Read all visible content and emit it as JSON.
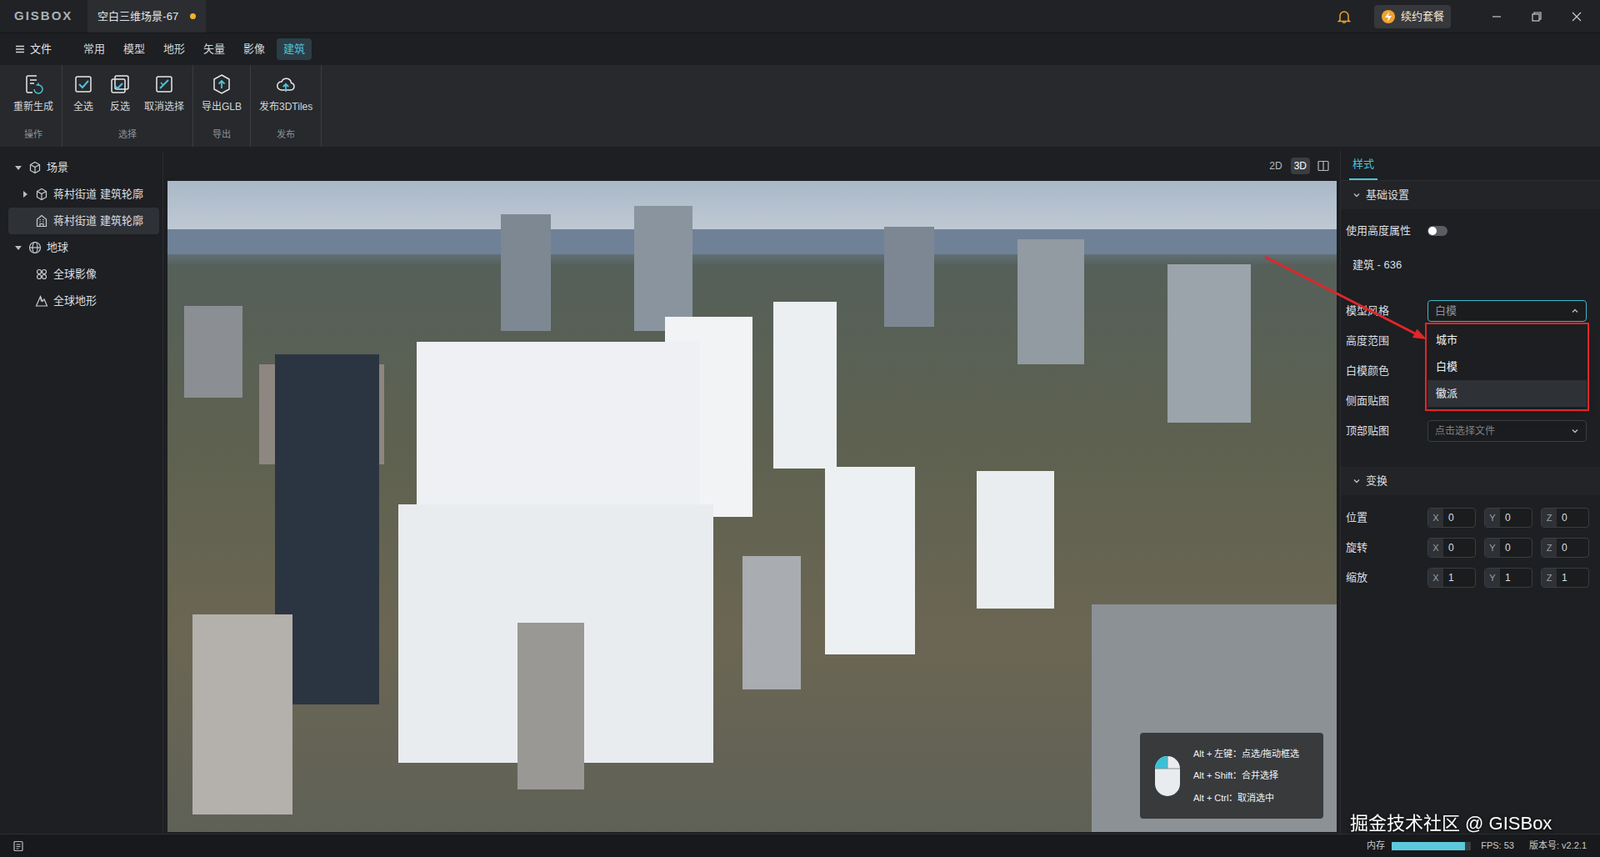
{
  "app": {
    "logo": "GISBOX",
    "document_tab": {
      "title": "空白三维场景-67",
      "unsaved": true
    },
    "renew_button": "续约套餐"
  },
  "menu": {
    "file": "文件",
    "items": [
      {
        "label": "常用",
        "selected": false
      },
      {
        "label": "模型",
        "selected": false
      },
      {
        "label": "地形",
        "selected": false
      },
      {
        "label": "矢量",
        "selected": false
      },
      {
        "label": "影像",
        "selected": false
      },
      {
        "label": "建筑",
        "selected": true
      }
    ]
  },
  "ribbon": {
    "groups": [
      {
        "label": "操作",
        "buttons": [
          "重新生成"
        ]
      },
      {
        "label": "选择",
        "buttons": [
          "全选",
          "反选",
          "取消选择"
        ]
      },
      {
        "label": "导出",
        "buttons": [
          "导出GLB"
        ]
      },
      {
        "label": "发布",
        "buttons": [
          "发布3DTiles"
        ]
      }
    ]
  },
  "scene_tree": [
    {
      "label": "场景",
      "kind": "scene",
      "level": 0,
      "expanded": true,
      "selected": false
    },
    {
      "label": "蒋村街道 建筑轮廓",
      "kind": "layer",
      "level": 1,
      "expanded": false,
      "selected": false
    },
    {
      "label": "蒋村街道 建筑轮廓",
      "kind": "building",
      "level": 1,
      "selected": true
    },
    {
      "label": "地球",
      "kind": "globe",
      "level": 0,
      "expanded": true,
      "selected": false
    },
    {
      "label": "全球影像",
      "kind": "imagery",
      "level": 1,
      "selected": false
    },
    {
      "label": "全球地形",
      "kind": "terrain",
      "level": 1,
      "selected": false
    }
  ],
  "view_modes": [
    {
      "label": "2D",
      "selected": false
    },
    {
      "label": "3D",
      "selected": true
    }
  ],
  "viewport": {
    "hints": [
      "Alt + 左键：点选/拖动框选",
      "Alt + Shift：合并选择",
      "Alt + Ctrl：取消选中"
    ],
    "watermark": "掘金技术社区 @ GISBox"
  },
  "panel": {
    "tabs": [
      {
        "label": "样式",
        "selected": true
      }
    ],
    "sections": [
      {
        "title": "基础设置",
        "expanded": true,
        "rows": [
          {
            "kind": "toggle",
            "label": "使用高度属性",
            "on": false
          },
          {
            "kind": "text",
            "text": "建筑 - 636"
          },
          {
            "kind": "select",
            "label": "模型风格",
            "value": "白模",
            "open": true,
            "options": [
              {
                "label": "城市",
                "highlighted": false
              },
              {
                "label": "白模",
                "highlighted": false
              },
              {
                "label": "徽派",
                "highlighted": true
              }
            ]
          },
          {
            "kind": "label",
            "label": "高度范围"
          },
          {
            "kind": "label",
            "label": "白模颜色"
          },
          {
            "kind": "label",
            "label": "侧面贴图"
          },
          {
            "kind": "file",
            "label": "顶部贴图",
            "placeholder": "点击选择文件"
          }
        ]
      },
      {
        "title": "变换",
        "expanded": true,
        "rows": [
          {
            "kind": "vector",
            "label": "位置",
            "values": [
              {
                "axis": "X",
                "value": "0"
              },
              {
                "axis": "Y",
                "value": "0"
              },
              {
                "axis": "Z",
                "value": "0"
              }
            ]
          },
          {
            "kind": "vector",
            "label": "旋转",
            "values": [
              {
                "axis": "X",
                "value": "0"
              },
              {
                "axis": "Y",
                "value": "0"
              },
              {
                "axis": "Z",
                "value": "0"
              }
            ]
          },
          {
            "kind": "vector",
            "label": "缩放",
            "values": [
              {
                "axis": "X",
                "value": "1"
              },
              {
                "axis": "Y",
                "value": "1"
              },
              {
                "axis": "Z",
                "value": "1"
              }
            ]
          }
        ]
      }
    ]
  },
  "status_bar": {
    "memory_label": "内存",
    "memory_level": 0.92,
    "fps": "FPS: 53",
    "version": "版本号: v2.2.1"
  }
}
